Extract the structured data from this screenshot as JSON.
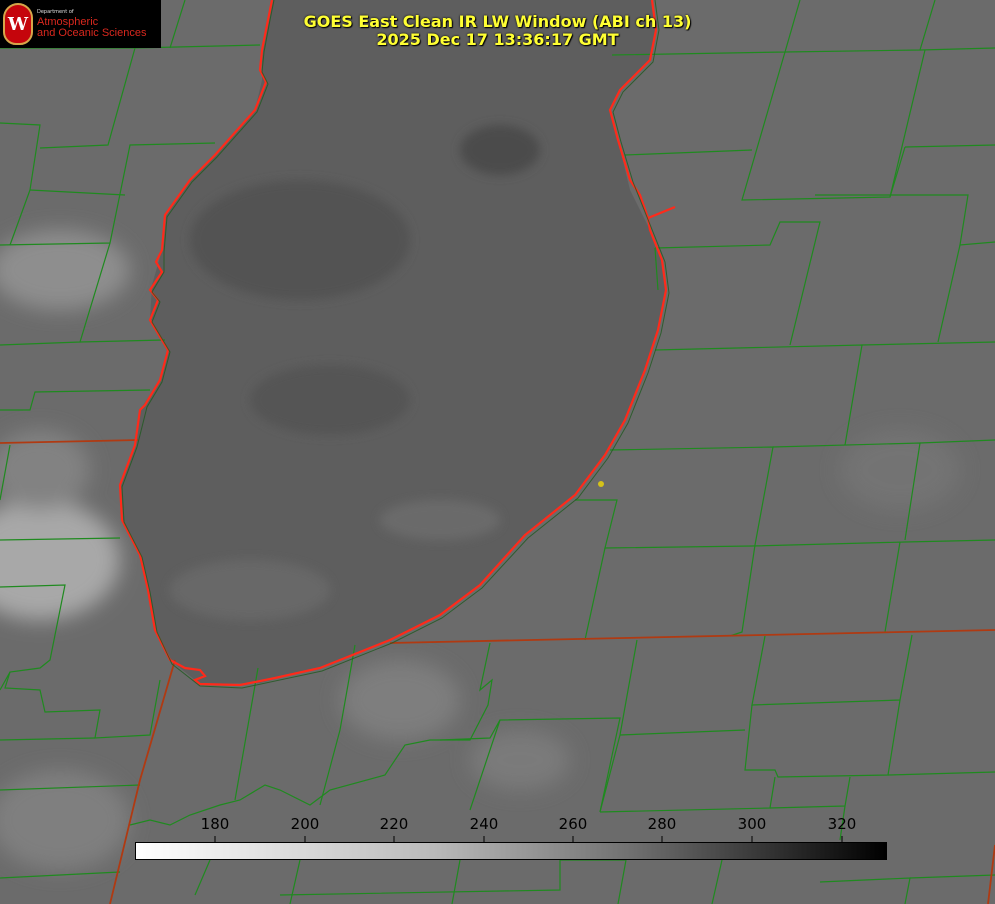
{
  "title": {
    "line1": "GOES East Clean IR LW Window (ABI ch 13)",
    "line2": "2025 Dec 17 13:36:17 GMT"
  },
  "logo": {
    "department": "Department of",
    "line1": "Atmospheric",
    "line2": "and Oceanic Sciences",
    "seal_letter": "W"
  },
  "colorbar": {
    "ticks": [
      "180",
      "200",
      "220",
      "240",
      "260",
      "280",
      "300",
      "320"
    ],
    "vmin": 163,
    "vmax": 330,
    "colormap": "white-to-black (cold = white, warm = black)"
  },
  "colors": {
    "title": "#ffff33",
    "lake_outline": "#ff2a1a",
    "county_lines": "#1f8a1f",
    "state_lines": "#b03a12",
    "marker": "#d4c21a",
    "background_gray": "#6b6b6b"
  }
}
